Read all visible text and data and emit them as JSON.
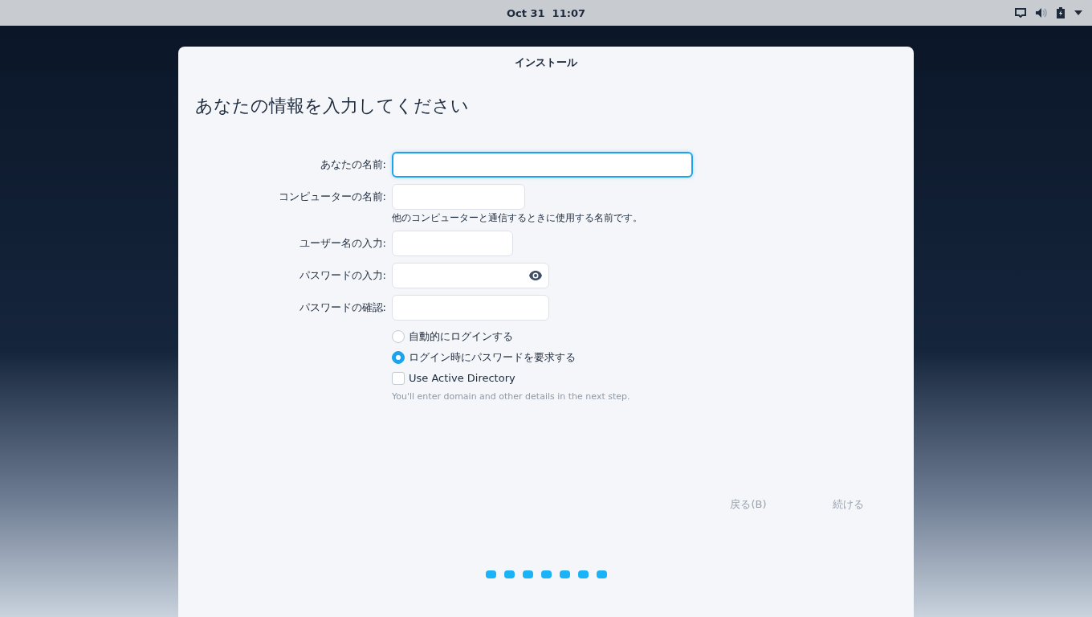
{
  "top_bar": {
    "clock": "Oct 31  11:07"
  },
  "window": {
    "title": "インストール"
  },
  "heading": "あなたの情報を入力してください",
  "fields": [
    {
      "label": "あなたの名前:",
      "focused": true
    },
    {
      "label": "コンピューターの名前:",
      "focused": false,
      "hint": "他のコンピューターと通信するときに使用する名前です。"
    },
    {
      "label": "ユーザー名の入力:",
      "focused": false
    },
    {
      "label": "パスワードの入力:",
      "focused": false,
      "reveal": true
    },
    {
      "label": "パスワードの確認:",
      "focused": false
    }
  ],
  "options": [
    {
      "kind": "radio",
      "label": "自動的にログインする",
      "selected": false
    },
    {
      "kind": "radio",
      "label": "ログイン時にパスワードを要求する",
      "selected": true
    },
    {
      "kind": "checkbox",
      "label": "Use Active Directory",
      "checked": false
    }
  ],
  "note": "You'll enter domain and other details in the next step.",
  "buttons": [
    {
      "label": "戻る(B)",
      "disabled": true
    },
    {
      "label": "続ける",
      "disabled": true
    }
  ],
  "steps": [
    {
      "done": true
    },
    {
      "done": true
    },
    {
      "done": true
    },
    {
      "done": true
    },
    {
      "done": true
    },
    {
      "done": true
    },
    {
      "done": true
    }
  ]
}
